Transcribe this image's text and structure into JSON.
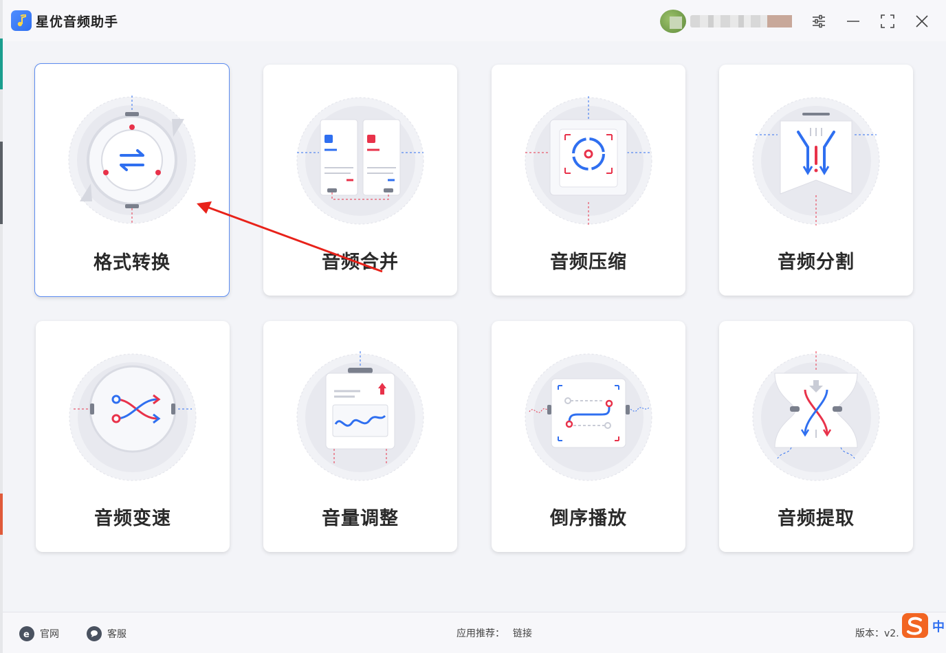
{
  "app": {
    "title": "星优音频助手"
  },
  "user": {
    "avatar": "avatar",
    "name": ""
  },
  "window_controls": [
    "settings-icon",
    "minimize-icon",
    "maximize-icon",
    "close-icon"
  ],
  "features": [
    {
      "label": "格式转换",
      "icon": "format-convert-icon",
      "selected": true
    },
    {
      "label": "音频合并",
      "icon": "audio-merge-icon",
      "selected": false
    },
    {
      "label": "音频压缩",
      "icon": "audio-compress-icon",
      "selected": false
    },
    {
      "label": "音频分割",
      "icon": "audio-split-icon",
      "selected": false
    },
    {
      "label": "音频变速",
      "icon": "audio-speed-icon",
      "selected": false
    },
    {
      "label": "音量调整",
      "icon": "volume-adjust-icon",
      "selected": false
    },
    {
      "label": "倒序播放",
      "icon": "reverse-play-icon",
      "selected": false
    },
    {
      "label": "音频提取",
      "icon": "audio-extract-icon",
      "selected": false
    }
  ],
  "footer": {
    "website": "官网",
    "service": "客服",
    "recommend_label": "应用推荐：",
    "recommend_link": "链接",
    "version": "版本：v2."
  },
  "ime": {
    "lang": "中"
  },
  "colors": {
    "accent": "#2f6ff0",
    "red": "#e8324a",
    "card_border_active": "#5b8bf0"
  }
}
